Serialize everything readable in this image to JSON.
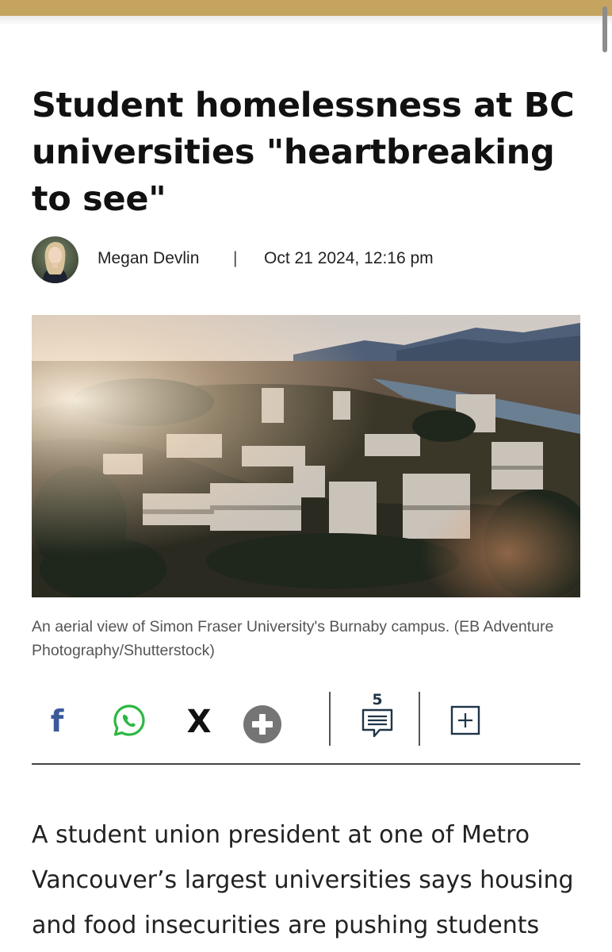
{
  "article": {
    "headline": "Student homelessness at BC universities \"heartbreaking to see\"",
    "author": "Megan Devlin",
    "separator": "|",
    "date": "Oct 21 2024, 12:16 pm",
    "image_caption": "An aerial view of Simon Fraser University's Burnaby campus. (EB Adventure Photography/Shutterstock)",
    "body_excerpt": "A student union president at one of Metro Vancouver’s largest universities says housing and food insecurities are pushing students"
  },
  "share": {
    "facebook_glyph": "f",
    "x_glyph": "X",
    "comment_count": "5"
  },
  "colors": {
    "top_bar": "#c5a460",
    "facebook": "#3b5a9a",
    "whatsapp": "#2cb742",
    "plus_circle": "#757575",
    "comment_icon": "#1f3447"
  },
  "icons": [
    "facebook-icon",
    "whatsapp-icon",
    "x-icon",
    "more-share-icon",
    "comment-icon",
    "save-icon"
  ]
}
